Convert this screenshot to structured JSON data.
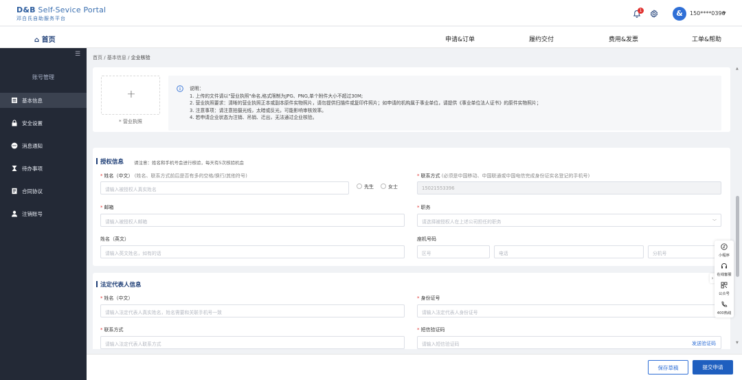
{
  "header": {
    "logo_brand": "D&B",
    "logo_text": " Self-Sevice Portal",
    "logo_sub": "邓白氏自助服务平台",
    "notification_count": "1",
    "avatar_glyph": "&",
    "user_phone": "150****0396"
  },
  "nav": {
    "home": "首页",
    "items": [
      "申请&订单",
      "履约交付",
      "费用&发票",
      "工单&帮助"
    ]
  },
  "sidebar": {
    "section_title": "账号管理",
    "items": [
      {
        "label": "基本信息",
        "icon": "document-icon",
        "active": true
      },
      {
        "label": "安全设置",
        "icon": "lock-icon",
        "active": false
      },
      {
        "label": "消息通知",
        "icon": "chat-icon",
        "active": false
      },
      {
        "label": "待办事项",
        "icon": "hourglass-icon",
        "active": false
      },
      {
        "label": "合同协议",
        "icon": "contract-icon",
        "active": false
      },
      {
        "label": "注销账号",
        "icon": "user-icon",
        "active": false
      }
    ]
  },
  "breadcrumb": {
    "items": [
      "首页",
      "基本信息",
      "企业核验"
    ],
    "separator": "/"
  },
  "upload": {
    "plus": "+",
    "label": "* 营业执照"
  },
  "notes": {
    "lines": [
      "说明：",
      "1. 上传的文件请以\"营业执照\"命名,格式限制为JPG、PNG,单个附件大小不超过30M;",
      "2. 营业执照要求：清晰的营业执照正本或副本原件实物照片，请勿提供扫描件或复印件照片；如申请的机构属于事业单位，请提供《事业单位法人证书》的原件实物照片；",
      "3. 注意事项：请注意拍摄光线，太暗或反光，可能影响审核效率。",
      "4. 若申请企业状态为注销、吊销、迁出，无法通过企业核验。"
    ]
  },
  "auth_section": {
    "title": "授权信息",
    "tip": "请注意：姓名和手机号会进行核验，每天有5次核验机会",
    "name_label": "姓名（中文）",
    "name_hint": "(姓名、联系方式前后是否有多的空格/换行/其他符号)",
    "name_placeholder": "请输入被授权人真实姓名",
    "gender_male": "先生",
    "gender_female": "女士",
    "phone_label": "联系方式",
    "phone_hint": "(必须是中国移动、中国联通或中国电信完成身份证实名登记的手机号)",
    "phone_value": "15021553396",
    "email_label": "邮箱",
    "email_placeholder": "请输入被授权人邮箱",
    "position_label": "职务",
    "position_placeholder": "请选择被授权人在上述公司担任的职务",
    "en_name_label": "姓名（英文）",
    "en_name_placeholder": "请输入英文姓名，如有的话",
    "landline_label": "座机号码",
    "area_code_placeholder": "区号",
    "tel_placeholder": "电话",
    "ext_placeholder": "分机号"
  },
  "legal_section": {
    "title": "法定代表人信息",
    "name_label": "姓名（中文）",
    "name_placeholder": "请输入法定代表人真实姓名，姓名需要和关联手机号一致",
    "id_label": "身份证号",
    "id_placeholder": "请输入法定代表人身份证号",
    "contact_label": "联系方式",
    "contact_placeholder": "请输入法定代表人联系方式",
    "code_label": "短信验证码",
    "code_placeholder": "请输入短信验证码",
    "send_code": "发送验证码"
  },
  "footer": {
    "save": "保存草稿",
    "submit": "提交申请"
  },
  "float_panel": {
    "items": [
      {
        "label": "小程序",
        "icon": "miniprogram-icon"
      },
      {
        "label": "在线客服",
        "icon": "headset-icon"
      },
      {
        "label": "公众号",
        "icon": "qrcode-icon"
      },
      {
        "label": "400热线",
        "icon": "phone-icon"
      }
    ],
    "toggle": "›"
  }
}
